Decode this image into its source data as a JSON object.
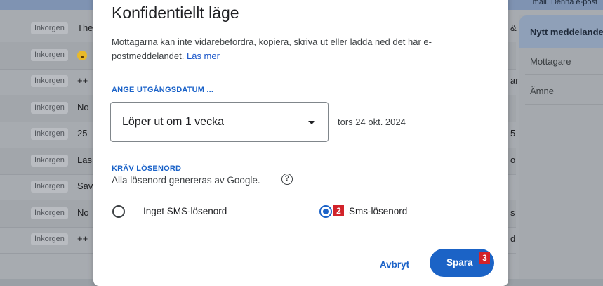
{
  "background": {
    "top_text": "mail. Denna e-post",
    "rows": [
      {
        "label": "Inkorgen",
        "snippet": "The",
        "right": "&"
      },
      {
        "label": "Inkorgen",
        "snippet": "",
        "emoji": true,
        "right": ""
      },
      {
        "label": "Inkorgen",
        "snippet": "++",
        "right": "ar"
      },
      {
        "label": "Inkorgen",
        "snippet": "No",
        "right": ""
      },
      {
        "label": "Inkorgen",
        "snippet": "25",
        "right": "5"
      },
      {
        "label": "Inkorgen",
        "snippet": "Las",
        "right": "o"
      },
      {
        "label": "Inkorgen",
        "snippet": "Sav",
        "right": ""
      },
      {
        "label": "Inkorgen",
        "snippet": "No",
        "right": "s"
      },
      {
        "label": "Inkorgen",
        "snippet": "++",
        "right": "d"
      }
    ],
    "compose": {
      "title": "Nytt meddelande",
      "to_label": "Mottagare",
      "subject_label": "Ämne"
    }
  },
  "dialog": {
    "title": "Konfidentiellt läge",
    "description": "Mottagarna kan inte vidarebefordra, kopiera, skriva ut eller ladda ned det här e-postmeddelandet.",
    "learn_more": "Läs mer",
    "expiry_heading": "ANGE UTGÅNGSDATUM ...",
    "expiry_value": "Löper ut om 1 vecka",
    "expiry_date": "tors 24 okt. 2024",
    "password_heading": "KRÄV LÖSENORD",
    "password_desc": "Alla lösenord genereras av Google.",
    "help_glyph": "?",
    "options": [
      {
        "label": "Inget SMS-lösenord",
        "selected": false
      },
      {
        "label": "Sms-lösenord",
        "selected": true
      }
    ],
    "cancel_label": "Avbryt",
    "save_label": "Spara",
    "badges": {
      "radio": "2",
      "save": "3"
    }
  },
  "colors": {
    "accent": "#1a62c8",
    "badge": "#d2232a"
  }
}
